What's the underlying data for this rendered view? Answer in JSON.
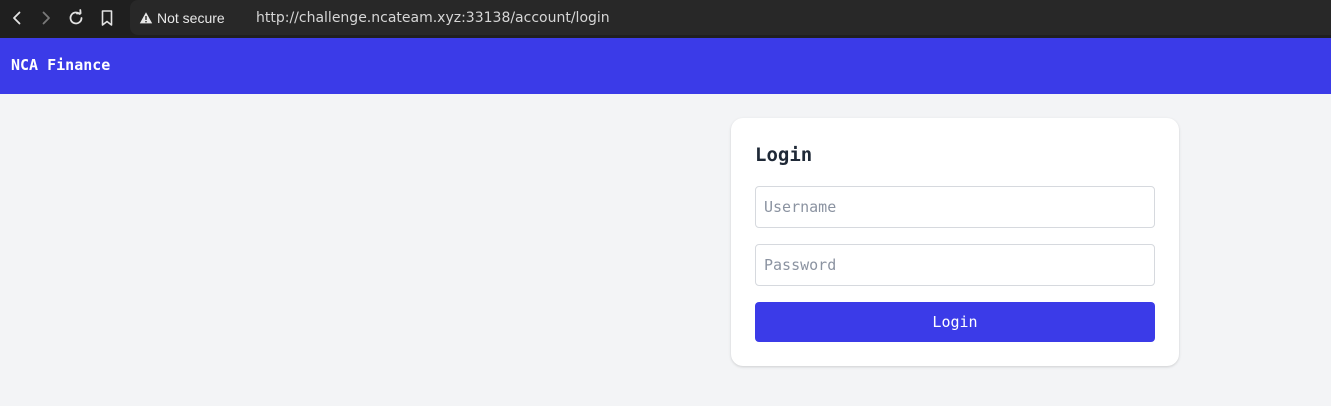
{
  "browser": {
    "security_label": "Not secure",
    "url": "http://challenge.ncateam.xyz:33138/account/login",
    "icons": [
      "back-icon",
      "forward-icon",
      "reload-icon",
      "bookmark-icon",
      "warning-icon"
    ],
    "colors": {
      "chrome_bg": "#1f1f1f",
      "omnibox_bg": "#282828"
    }
  },
  "header": {
    "brand": "NCA Finance",
    "bg_color": "#3b3be8"
  },
  "login": {
    "title": "Login",
    "username": {
      "value": "",
      "placeholder": "Username"
    },
    "password": {
      "value": "",
      "placeholder": "Password"
    },
    "submit_label": "Login",
    "button_color": "#3b3be8"
  },
  "page": {
    "bg_color": "#f3f4f6"
  }
}
